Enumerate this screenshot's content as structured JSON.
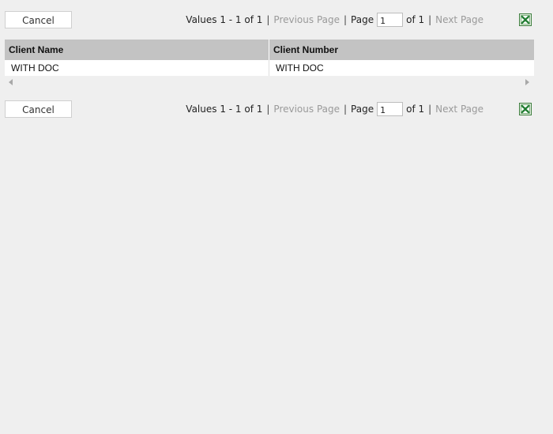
{
  "toolbar_top": {
    "cancel_label": "Cancel",
    "values_text": "Values 1 - 1 of 1",
    "previous_label": "Previous Page",
    "page_label": "Page",
    "page_value": "1",
    "of_label": "of 1",
    "next_label": "Next Page",
    "export_icon": "excel-export-icon"
  },
  "grid": {
    "columns": [
      "Client Name",
      "Client Number"
    ],
    "rows": [
      [
        "WITH DOC",
        "WITH DOC"
      ]
    ]
  },
  "toolbar_bottom": {
    "cancel_label": "Cancel",
    "values_text": "Values 1 - 1 of 1",
    "previous_label": "Previous Page",
    "page_label": "Page",
    "page_value": "1",
    "of_label": "of 1",
    "next_label": "Next Page",
    "export_icon": "excel-export-icon"
  },
  "colors": {
    "background": "#efefef",
    "header_bg": "#c3c3c3",
    "excel_green": "#1e7a2f",
    "disabled_link": "#9a9a9a"
  }
}
